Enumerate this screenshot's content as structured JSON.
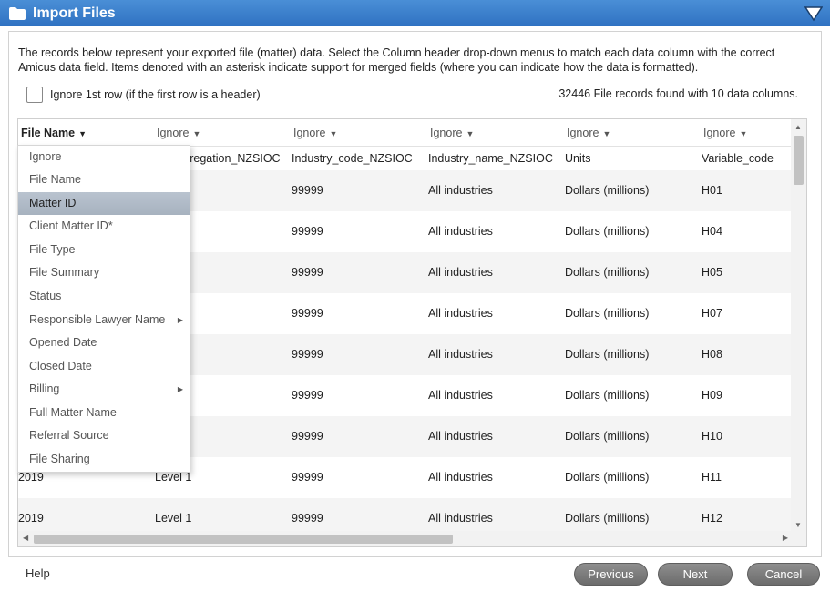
{
  "window": {
    "title": "Import Files"
  },
  "description": "The records below represent your exported file (matter) data. Select the Column header drop-down menus to match each data column with the correct Amicus data field. Items denoted with an asterisk indicate support for merged fields (where you can indicate how the data is formatted).",
  "ignore_first_row": {
    "label": "Ignore 1st row (if the first row is a header)",
    "checked": false
  },
  "records_found": "32446 File records found with 10 data columns.",
  "columns": [
    {
      "label": "File Name",
      "active": true
    },
    {
      "label": "Ignore"
    },
    {
      "label": "Ignore"
    },
    {
      "label": "Ignore"
    },
    {
      "label": "Ignore"
    },
    {
      "label": "Ignore"
    }
  ],
  "rows": [
    [
      "",
      "ry_aggregation_NZSIOC",
      "Industry_code_NZSIOC",
      "Industry_name_NZSIOC",
      "Units",
      "Variable_code"
    ],
    [
      "",
      "",
      "99999",
      "All industries",
      "Dollars (millions)",
      "H01"
    ],
    [
      "",
      "",
      "99999",
      "All industries",
      "Dollars (millions)",
      "H04"
    ],
    [
      "",
      "",
      "99999",
      "All industries",
      "Dollars (millions)",
      "H05"
    ],
    [
      "",
      "",
      "99999",
      "All industries",
      "Dollars (millions)",
      "H07"
    ],
    [
      "",
      "",
      "99999",
      "All industries",
      "Dollars (millions)",
      "H08"
    ],
    [
      "",
      "",
      "99999",
      "All industries",
      "Dollars (millions)",
      "H09"
    ],
    [
      "",
      "",
      "99999",
      "All industries",
      "Dollars (millions)",
      "H10"
    ],
    [
      "2019",
      "Level 1",
      "99999",
      "All industries",
      "Dollars (millions)",
      "H11"
    ],
    [
      "2019",
      "Level 1",
      "99999",
      "All industries",
      "Dollars (millions)",
      "H12"
    ]
  ],
  "dropdown": {
    "items": [
      {
        "label": "Ignore"
      },
      {
        "label": "File Name"
      },
      {
        "label": "Matter ID",
        "selected": true
      },
      {
        "label": "Client Matter ID*"
      },
      {
        "label": "File Type"
      },
      {
        "label": "File Summary"
      },
      {
        "label": "Status"
      },
      {
        "label": "Responsible Lawyer Name",
        "submenu": true
      },
      {
        "label": "Opened Date"
      },
      {
        "label": "Closed Date"
      },
      {
        "label": "Billing",
        "submenu": true
      },
      {
        "label": "Full Matter Name"
      },
      {
        "label": "Referral Source"
      },
      {
        "label": "File Sharing"
      }
    ]
  },
  "footer": {
    "help_label": "Help",
    "previous_label": "Previous",
    "next_label": "Next",
    "cancel_label": "Cancel"
  },
  "icons": {
    "title_icon": "folder-icon",
    "collapse": "triangle-down-icon",
    "header_dropdown": "caret-down-icon",
    "submenu": "caret-right-icon"
  },
  "colors": {
    "titlebar": "#3a7fcc",
    "button": "#7a7a7a",
    "selected_item": "#b0bbc7"
  }
}
